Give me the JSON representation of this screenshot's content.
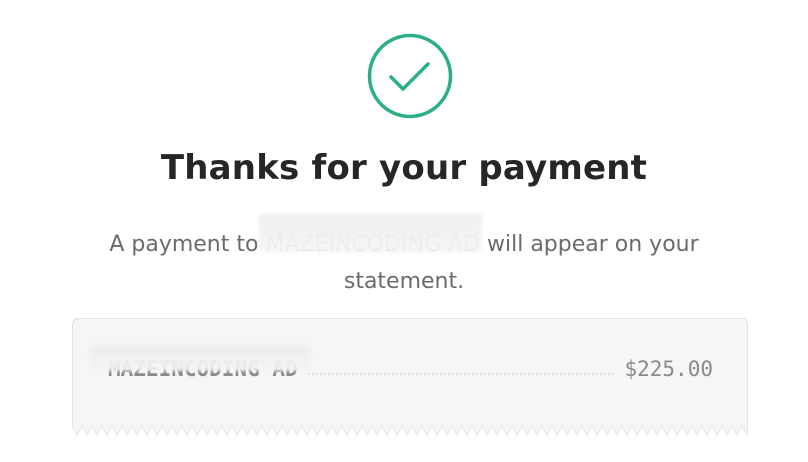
{
  "status": {
    "icon": "checkmark-circle-icon",
    "accent_color": "#2bb07f"
  },
  "heading": {
    "title": "Thanks for your payment"
  },
  "message": {
    "prefix": "A payment to ",
    "merchant": "MAZEINCODING AD",
    "suffix": " will appear on your",
    "line2": "statement."
  },
  "receipt": {
    "merchant": "MAZEINCODING AD",
    "amount": "$225.00"
  }
}
